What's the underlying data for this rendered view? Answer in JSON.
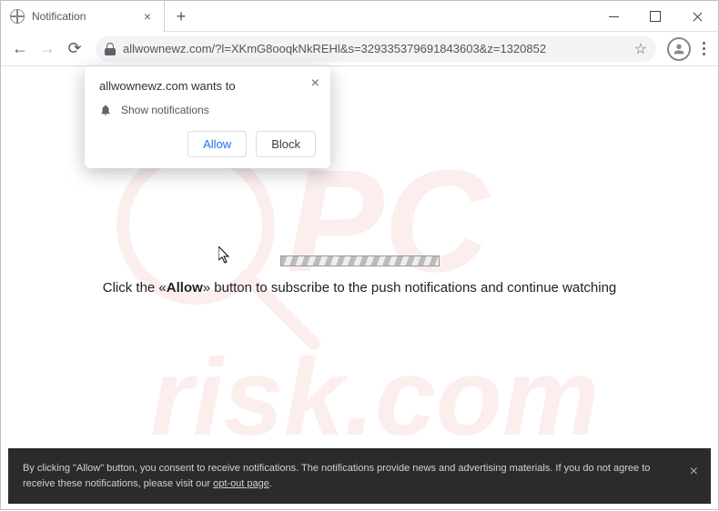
{
  "browser": {
    "tab_title": "Notification",
    "url_text": "allwownewz.com/?l=XKmG8ooqkNkREHl&s=329335379691843603&z=1320852"
  },
  "popup": {
    "wants_to": "allwownewz.com wants to",
    "show_notifications": "Show notifications",
    "allow": "Allow",
    "block": "Block"
  },
  "page": {
    "message_prefix": "Click the «",
    "message_bold": "Allow",
    "message_suffix": "» button to subscribe to the push notifications and continue watching"
  },
  "banner": {
    "text": "By clicking \"Allow\" button, you consent to receive notifications. The notifications provide news and advertising materials. If you do not agree to receive these notifications, please visit our ",
    "link": "opt-out page",
    "period": "."
  },
  "watermark": {
    "line1": "PC",
    "line2": "risk.com"
  }
}
